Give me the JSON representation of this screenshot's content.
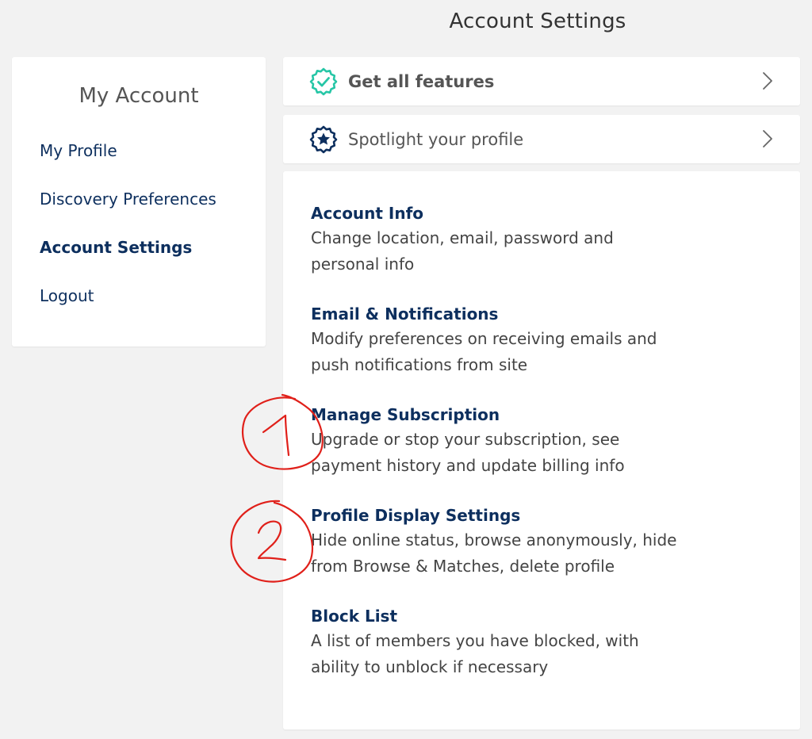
{
  "page": {
    "title": "Account Settings"
  },
  "sidebar": {
    "title": "My Account",
    "items": [
      {
        "label": "My Profile",
        "active": false
      },
      {
        "label": "Discovery Preferences",
        "active": false
      },
      {
        "label": "Account Settings",
        "active": true
      },
      {
        "label": "Logout",
        "active": false
      }
    ]
  },
  "promos": {
    "features": {
      "label": "Get all features",
      "icon": "verified-badge-icon"
    },
    "spotlight": {
      "label": "Spotlight your profile",
      "icon": "star-badge-icon"
    }
  },
  "settings": [
    {
      "title": "Account Info",
      "desc": "Change location, email, password and personal info"
    },
    {
      "title": "Email & Notifications",
      "desc": "Modify preferences on receiving emails and push notifications from site"
    },
    {
      "title": "Manage Subscription",
      "desc": "Upgrade or stop your subscription, see payment history and update billing info"
    },
    {
      "title": "Profile Display Settings",
      "desc": "Hide online status, browse anonymously, hide from Browse & Matches, delete profile"
    },
    {
      "title": "Block List",
      "desc": "A list of members you have blocked, with ability to unblock if necessary"
    }
  ],
  "annotations": [
    {
      "label": "1"
    },
    {
      "label": "2"
    }
  ],
  "colors": {
    "navy": "#0d2f5e",
    "teal": "#26c6a6",
    "annotation_red": "#e0201a",
    "background": "#f2f2f2"
  }
}
